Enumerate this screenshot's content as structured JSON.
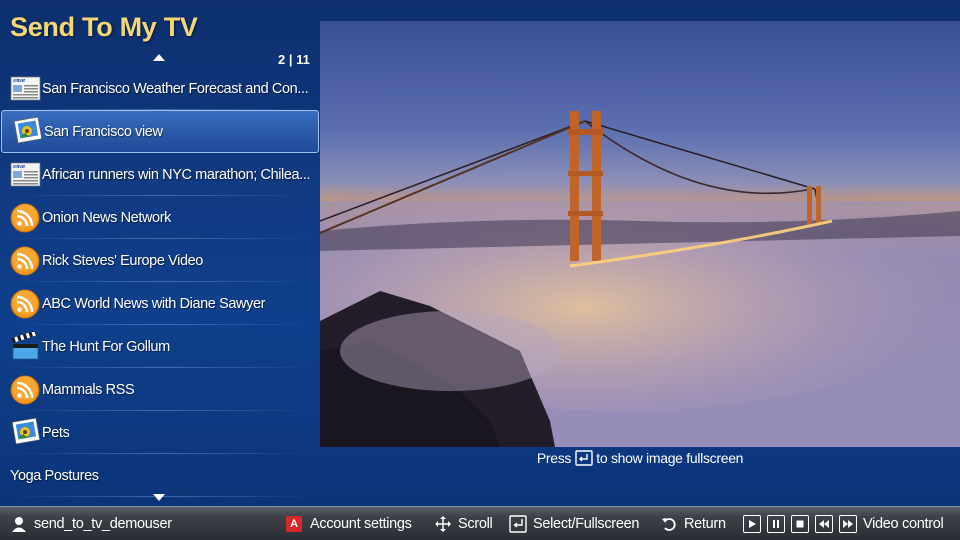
{
  "app": {
    "title": "Send To My TV"
  },
  "pager": {
    "text": "2 | 11"
  },
  "list": {
    "items": [
      {
        "label": "San Francisco Weather Forecast and Con...",
        "icon": "news-icon"
      },
      {
        "label": "San Francisco view",
        "icon": "photo-icon",
        "selected": true
      },
      {
        "label": "African runners win NYC marathon; Chilea...",
        "icon": "news-icon"
      },
      {
        "label": "Onion News Network",
        "icon": "rss-icon"
      },
      {
        "label": "Rick Steves' Europe Video",
        "icon": "rss-icon"
      },
      {
        "label": "ABC World News with Diane Sawyer",
        "icon": "rss-icon"
      },
      {
        "label": "The Hunt For Gollum",
        "icon": "clapperboard-icon"
      },
      {
        "label": "Mammals RSS",
        "icon": "rss-icon"
      },
      {
        "label": "Pets",
        "icon": "photo-icon"
      },
      {
        "label": "Yoga Postures",
        "icon": ""
      }
    ]
  },
  "preview": {
    "caption_prefix": "Press",
    "caption_suffix": "to show image fullscreen"
  },
  "footer": {
    "username": "send_to_tv_demouser",
    "a_key": "A",
    "account_settings": "Account settings",
    "scroll": "Scroll",
    "select": "Select/Fullscreen",
    "return": "Return",
    "video_control": "Video control"
  },
  "colors": {
    "title": "#f4d777",
    "background": "#0f3f8c",
    "selected": "#2a5aaa",
    "a_key": "#d8262c"
  }
}
